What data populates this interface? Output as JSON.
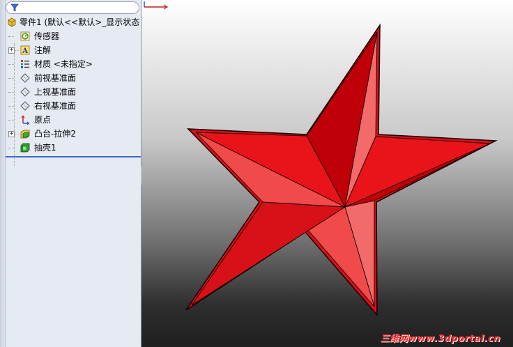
{
  "filter": {
    "icon": "filter-icon"
  },
  "tree": {
    "root": {
      "label": "零件1  (默认<<默认>_显示状态"
    },
    "items": [
      {
        "label": "传感器",
        "icon": "sensor-icon",
        "expandable": false
      },
      {
        "label": "注解",
        "icon": "annotation-icon",
        "expandable": true
      },
      {
        "label": "材质 <未指定>",
        "icon": "material-icon",
        "expandable": false
      },
      {
        "label": "前视基准面",
        "icon": "plane-icon",
        "expandable": false
      },
      {
        "label": "上视基准面",
        "icon": "plane-icon",
        "expandable": false
      },
      {
        "label": "右视基准面",
        "icon": "plane-icon",
        "expandable": false
      },
      {
        "label": "原点",
        "icon": "origin-icon",
        "expandable": false
      },
      {
        "label": "凸台-拉伸2",
        "icon": "extrude-boss-icon",
        "expandable": true
      },
      {
        "label": "抽壳1",
        "icon": "shell-icon",
        "expandable": false
      }
    ],
    "expander_symbol": "+"
  },
  "viewport": {
    "model": "star-model",
    "watermark": "三维网www.3dportal.cn",
    "colors": {
      "star_base": "#e8141a",
      "star_dark": "#c00008",
      "star_light": "#f04a4a",
      "star_lighter": "#f26a6a",
      "outline": "#1a0000"
    }
  }
}
